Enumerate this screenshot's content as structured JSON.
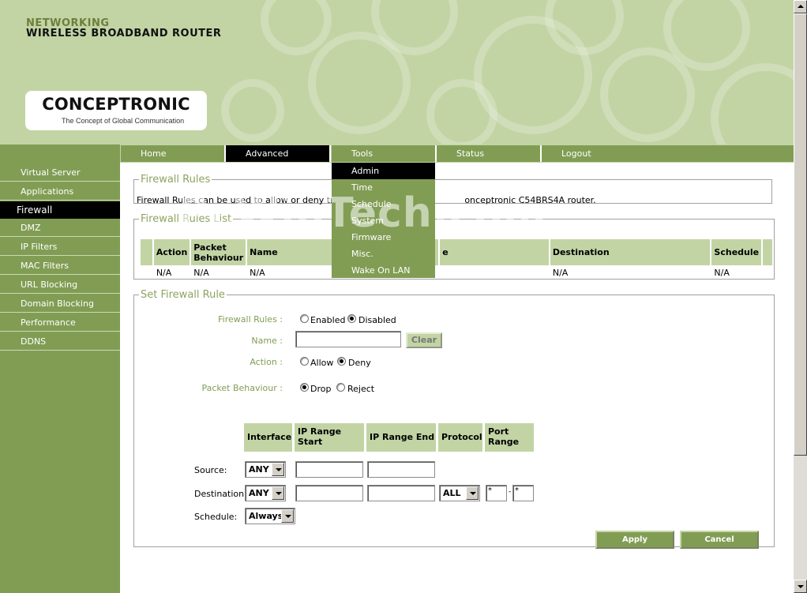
{
  "header": {
    "brand_line1": "NETWORKING",
    "brand_line2": "WIRELESS BROADBAND ROUTER",
    "logo_name": "CONCEPTRONIC",
    "logo_tagline": "The Concept of Global Communication"
  },
  "nav": {
    "items": [
      {
        "label": "Home"
      },
      {
        "label": "Advanced",
        "active": true
      },
      {
        "label": "Tools"
      },
      {
        "label": "Status"
      },
      {
        "label": "Logout"
      }
    ]
  },
  "tools_menu": {
    "items": [
      "Admin",
      "Time",
      "Schedule",
      "System",
      "Firmware",
      "Misc.",
      "Wake On LAN"
    ],
    "highlighted": "Admin"
  },
  "sidebar": {
    "items": [
      "Virtual Server",
      "Applications",
      "Firewall",
      "DMZ",
      "IP Filters",
      "MAC Filters",
      "URL Blocking",
      "Domain Blocking",
      "Performance",
      "DDNS"
    ],
    "active": "Firewall"
  },
  "firewall_rules": {
    "legend": "Firewall Rules",
    "description_start": "Firewall Rules can be used to allow or deny traffic f",
    "description_end": "onceptronic C54BRS4A router."
  },
  "rules_list": {
    "legend": "Firewall Rules List",
    "columns": [
      "",
      "Action",
      "Packet Behaviour",
      "Name",
      "e",
      "Destination",
      "Schedule",
      ""
    ],
    "rows": [
      [
        "",
        "N/A",
        "N/A",
        "N/A",
        "",
        "N/A",
        "N/A",
        ""
      ]
    ]
  },
  "set_rule": {
    "legend": "Set Firewall Rule",
    "firewall_rules_label": "Firewall Rules :",
    "enabled_label": "Enabled",
    "disabled_label": "Disabled",
    "firewall_rules_value": "Disabled",
    "name_label": "Name :",
    "name_value": "",
    "clear_label": "Clear",
    "action_label": "Action :",
    "allow_label": "Allow",
    "deny_label": "Deny",
    "action_value": "Deny",
    "packet_label": "Packet Behaviour :",
    "drop_label": "Drop",
    "reject_label": "Reject",
    "packet_value": "Drop",
    "table_headers": {
      "interface": "Interface",
      "ip_start": "IP Range Start",
      "ip_end": "IP Range End",
      "protocol": "Protocol",
      "port_range": "Port Range"
    },
    "source_label": "Source:",
    "source_interface": "ANY",
    "destination_label": "Destination:",
    "destination_interface": "ANY",
    "destination_protocol": "ALL",
    "port_from": "*",
    "port_to": "*",
    "port_sep": "-",
    "schedule_label": "Schedule:",
    "schedule_value": "Always",
    "apply_label": "Apply",
    "cancel_label": "Cancel"
  },
  "watermark": "PcWinTech.com",
  "colors": {
    "accent_green": "#819d54",
    "light_green": "#c2d4a4",
    "label_green": "#8da360"
  }
}
